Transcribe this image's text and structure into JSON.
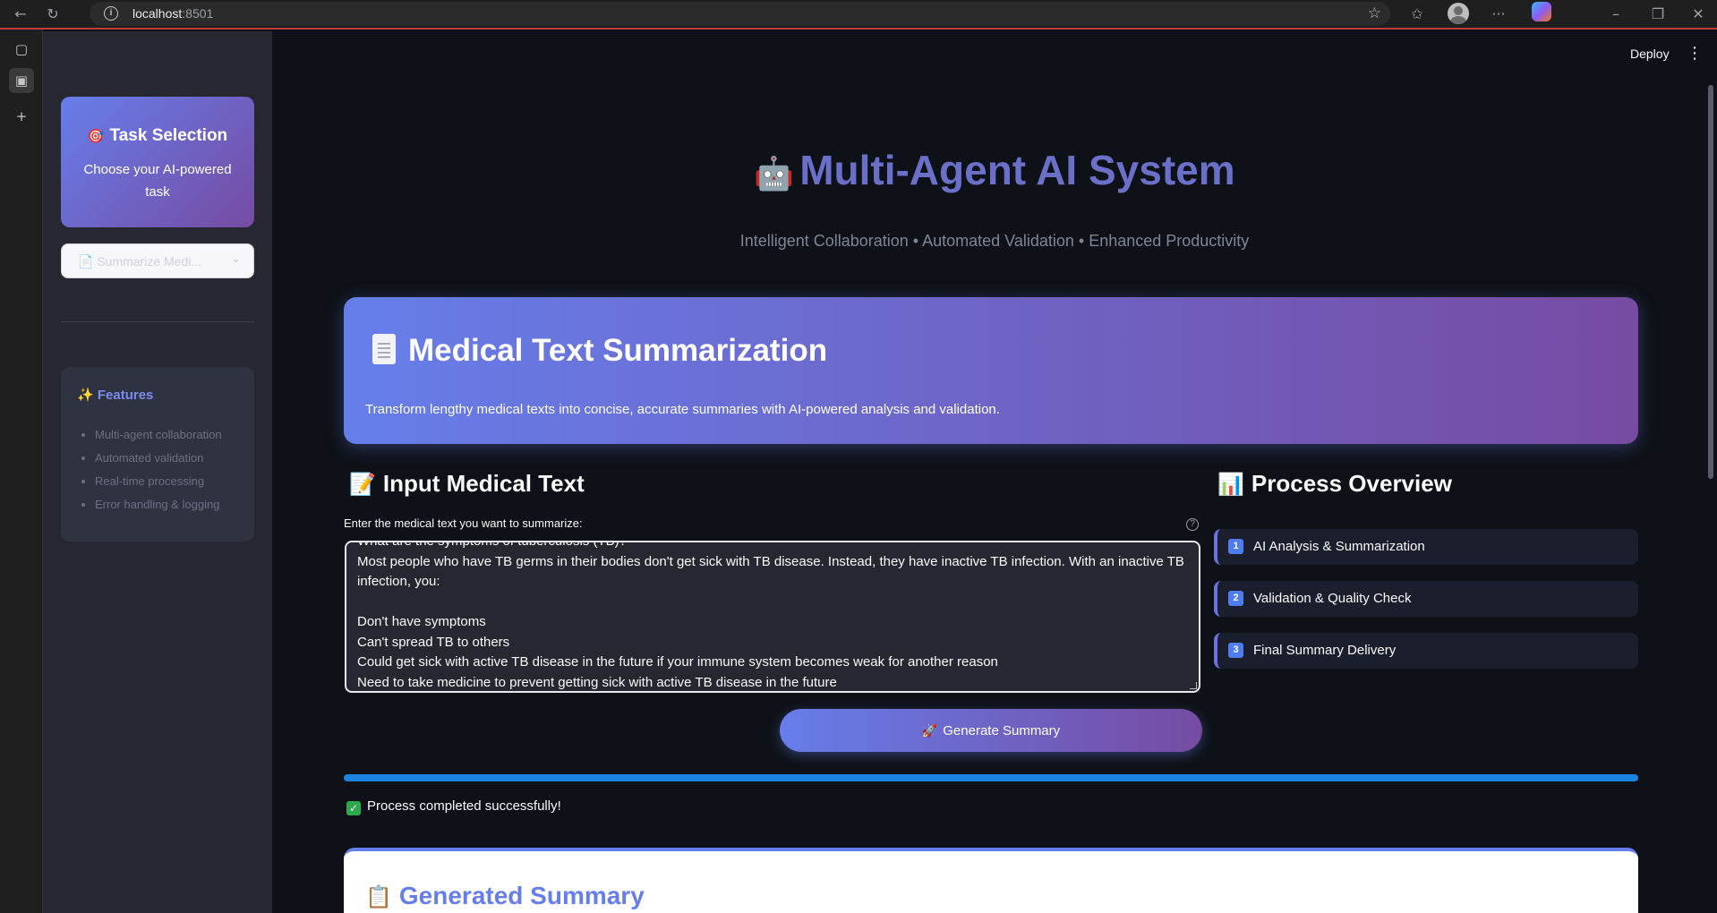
{
  "browser": {
    "url_host": "localhost",
    "url_port": ":8501"
  },
  "header": {
    "deploy_label": "Deploy"
  },
  "sidebar": {
    "task_card": {
      "icon": "🎯",
      "title": "Task Selection",
      "subtitle": "Choose your AI-powered task"
    },
    "task_select": {
      "value": "📄 Summarize Medi..."
    },
    "features": {
      "icon": "✨",
      "title": "Features",
      "items": [
        "Multi-agent collaboration",
        "Automated validation",
        "Real-time processing",
        "Error handling & logging"
      ]
    }
  },
  "hero": {
    "icon": "🤖",
    "title": "Multi-Agent AI System",
    "subtitle": "Intelligent Collaboration • Automated Validation • Enhanced Productivity"
  },
  "banner": {
    "title": "Medical Text Summarization",
    "description": "Transform lengthy medical texts into concise, accurate summaries with AI-powered analysis and validation."
  },
  "input_section": {
    "icon": "📝",
    "title": "Input Medical Text",
    "label": "Enter the medical text you want to summarize:",
    "help_icon": "?",
    "text": "What are the symptoms of tuberculosis (TB)?\nMost people who have TB germs in their bodies don't get sick with TB disease. Instead, they have inactive TB infection. With an inactive TB infection, you:\n\nDon't have symptoms\nCan't spread TB to others\nCould get sick with active TB disease in the future if your immune system becomes weak for another reason\nNeed to take medicine to prevent getting sick with active TB disease in the future",
    "button_icon": "🚀",
    "button_label": "Generate Summary"
  },
  "process_section": {
    "icon": "📊",
    "title": "Process Overview",
    "steps": [
      {
        "num": "1",
        "label": "AI Analysis & Summarization"
      },
      {
        "num": "2",
        "label": "Validation & Quality Check"
      },
      {
        "num": "3",
        "label": "Final Summary Delivery"
      }
    ]
  },
  "progress": {
    "value": 1.0,
    "color": "#1c83e1"
  },
  "status": {
    "icon": "✓",
    "text": "Process completed successfully!"
  },
  "summary": {
    "icon": "📋",
    "title": "Generated Summary"
  },
  "colors": {
    "accent_start": "#667eea",
    "accent_end": "#764ba2",
    "success": "#2eaa4e",
    "background": "#0e1117",
    "sidebar": "#262730"
  }
}
